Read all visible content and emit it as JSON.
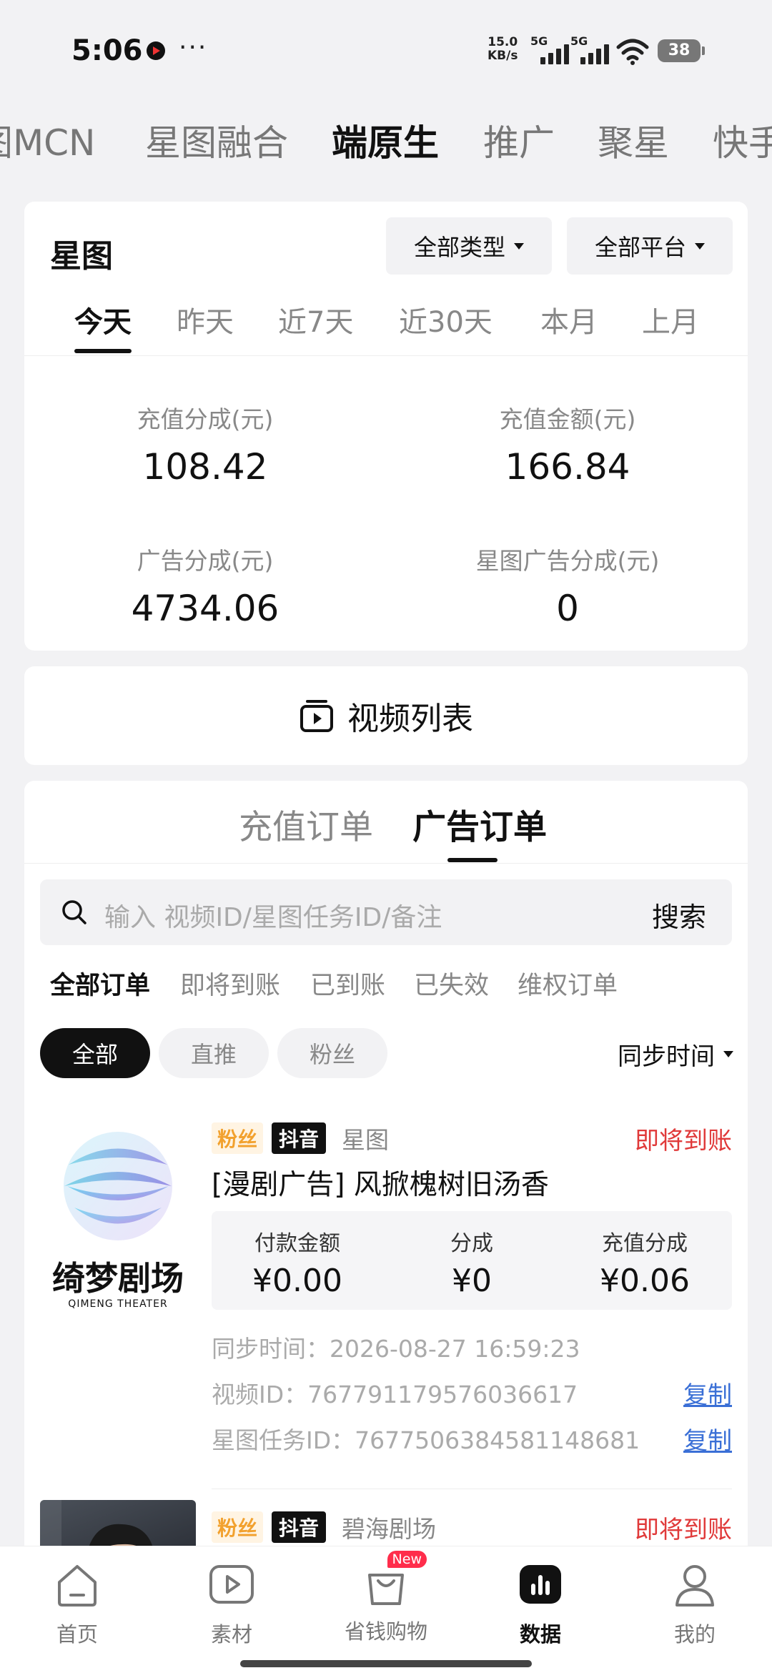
{
  "status_bar": {
    "time": "5:06",
    "dots": "···",
    "speed_top": "15.0",
    "speed_bottom": "KB/s",
    "net1": "5G",
    "net2": "5G",
    "battery": "38"
  },
  "top_tabs": [
    "图MCN",
    "星图融合",
    "端原生",
    "推广",
    "聚星",
    "快手"
  ],
  "stats": {
    "title": "星图",
    "filter_type": "全部类型",
    "filter_platform": "全部平台",
    "date_tabs": [
      "今天",
      "昨天",
      "近7天",
      "近30天",
      "本月",
      "上月"
    ],
    "items": [
      {
        "label": "充值分成(元)",
        "value": "108.42"
      },
      {
        "label": "充值金额(元)",
        "value": "166.84"
      },
      {
        "label": "广告分成(元)",
        "value": "4734.06"
      },
      {
        "label": "星图广告分成(元)",
        "value": "0"
      }
    ]
  },
  "video_list": {
    "label": "视频列表"
  },
  "orders": {
    "tabs": [
      "充值订单",
      "广告订单"
    ],
    "search_placeholder": "输入 视频ID/星图任务ID/备注",
    "search_button": "搜索",
    "status_tabs": [
      "全部订单",
      "即将到账",
      "已到账",
      "已失效",
      "维权订单"
    ],
    "chips": [
      "全部",
      "直推",
      "粉丝"
    ],
    "sort_label": "同步时间",
    "items": [
      {
        "logo_text": "绮梦剧场",
        "logo_sub": "QIMENG THEATER",
        "tag_fan": "粉丝",
        "tag_platform": "抖音",
        "source": "星图",
        "status": "即将到账",
        "title": "[漫剧广告] 风掀槐树旧汤香",
        "pay_label": "付款金额",
        "pay_value": "¥0.00",
        "share_label": "分成",
        "share_value": "¥0",
        "recharge_label": "充值分成",
        "recharge_value": "¥0.06",
        "sync_time": "同步时间：2026-08-27 16:59:23",
        "video_id": "视频ID：7677911795760366​17",
        "task_id": "星图任务ID：7677506384581148681",
        "copy": "复制"
      },
      {
        "tag_fan": "粉丝",
        "tag_platform": "抖音",
        "source": "碧海剧场",
        "status": "即将到账"
      }
    ]
  },
  "bottom_nav": [
    {
      "label": "首页",
      "icon": "home-icon"
    },
    {
      "label": "素材",
      "icon": "play-icon"
    },
    {
      "label": "省钱购物",
      "icon": "shopping-bag-icon",
      "badge": "New"
    },
    {
      "label": "数据",
      "icon": "chart-icon"
    },
    {
      "label": "我的",
      "icon": "user-icon"
    }
  ]
}
